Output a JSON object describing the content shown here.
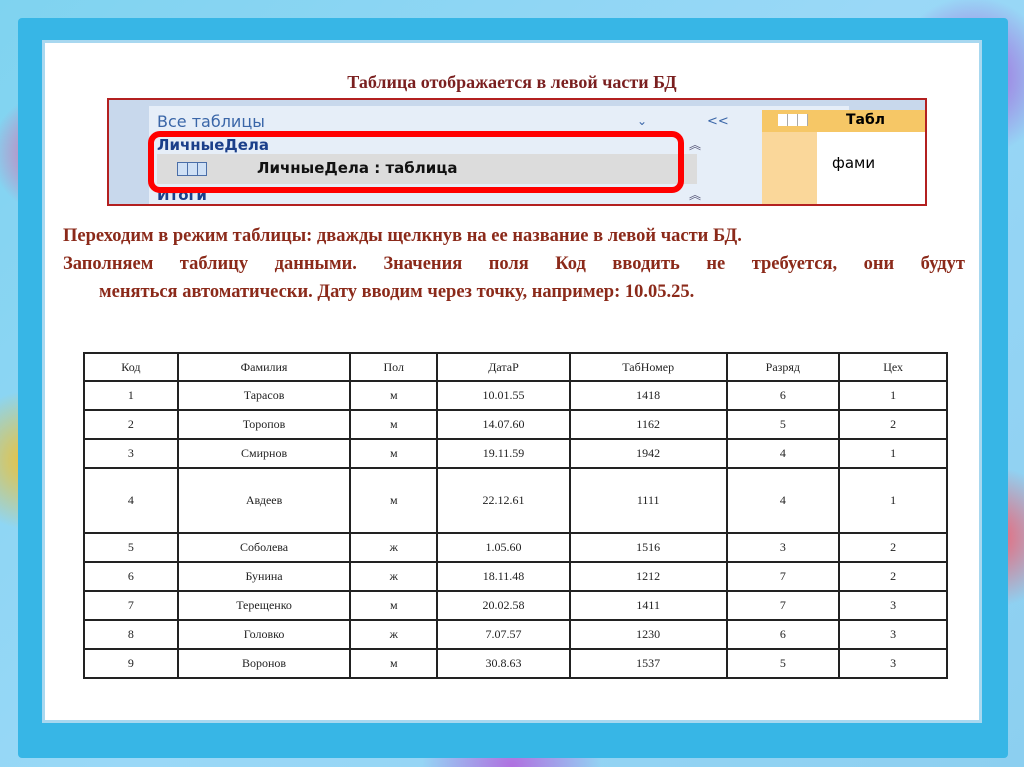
{
  "title": "Таблица отображается в левой части БД",
  "access": {
    "nav_header": "Все таблицы",
    "collapse": "<<",
    "group1": "ЛичныеДела",
    "item": "ЛичныеДела : таблица",
    "group2": "Итоги",
    "tab": "Табл",
    "field": "фами",
    "highlight_color": "#ff0000"
  },
  "paragraphs": [
    "Переходим в режим таблицы: дважды щелкнув на ее название в левой части БД.",
    "Заполняем таблицу данными. Значения поля Код вводить не требуется, они будут",
    "меняться автоматически. Дату вводим через точку, например: 10.05.25."
  ],
  "table": {
    "headers": [
      "Код",
      "Фамилия",
      "Пол",
      "ДатаР",
      "ТабНомер",
      "Разряд",
      "Цех"
    ],
    "rows": [
      [
        "1",
        "Тарасов",
        "м",
        "10.01.55",
        "1418",
        "6",
        "1"
      ],
      [
        "2",
        "Торопов",
        "м",
        "14.07.60",
        "1162",
        "5",
        "2"
      ],
      [
        "3",
        "Смирнов",
        "м",
        "19.11.59",
        "1942",
        "4",
        "1"
      ],
      [
        "4",
        "Авдеев",
        "м",
        "22.12.61",
        "1111",
        "4",
        "1"
      ],
      [
        "5",
        "Соболева",
        "ж",
        "1.05.60",
        "1516",
        "3",
        "2"
      ],
      [
        "6",
        "Бунина",
        "ж",
        "18.11.48",
        "1212",
        "7",
        "2"
      ],
      [
        "7",
        "Терещенко",
        "м",
        "20.02.58",
        "1411",
        "7",
        "3"
      ],
      [
        "8",
        "Головко",
        "ж",
        "7.07.57",
        "1230",
        "6",
        "3"
      ],
      [
        "9",
        "Воронов",
        "м",
        "30.8.63",
        "1537",
        "5",
        "3"
      ]
    ]
  }
}
